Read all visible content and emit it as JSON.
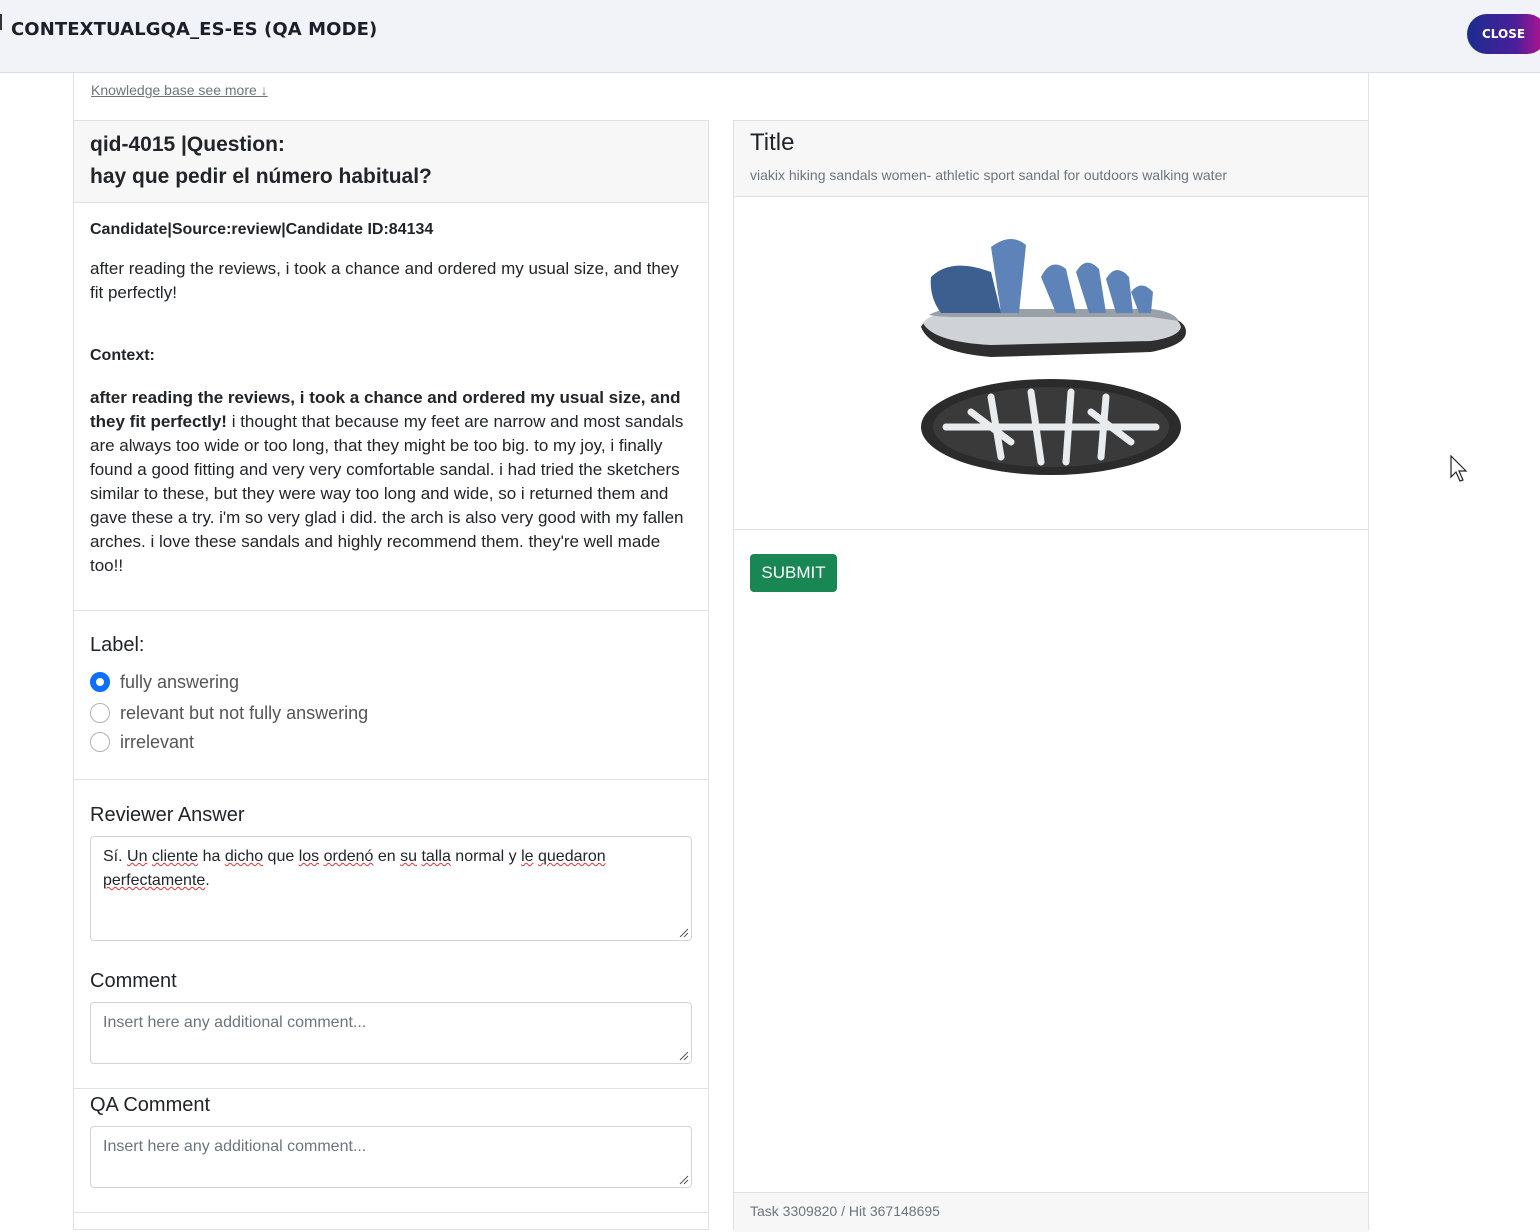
{
  "app": {
    "title": "CONTEXTUALGQA_ES-ES (QA MODE)",
    "close_label": "CLOSE"
  },
  "knowledge": {
    "link": "Knowledge base see more ↓"
  },
  "question": {
    "id_line": "qid-4015 |Question:",
    "text": "hay que pedir el número habitual?"
  },
  "candidate": {
    "title": "Candidate|Source:review|Candidate ID:84134",
    "text": "after reading the reviews, i took a chance and ordered my usual size, and they fit perfectly!"
  },
  "context": {
    "title": "Context:",
    "highlight": "after reading the reviews, i took a chance and ordered my usual size, and they fit perfectly!",
    "rest": " i thought that because my feet are narrow and most sandals are always too wide or too long, that they might be too big. to my joy, i finally found a good fitting and very very comfortable sandal. i had tried the sketchers similar to these, but they were way too long and wide, so i returned them and gave these a try. i'm so very glad i did. the arch is also very good with my fallen arches. i love these sandals and highly recommend them. they're well made too!!"
  },
  "label": {
    "title": "Label:",
    "options": [
      "fully answering",
      "relevant but not fully answering",
      "irrelevant"
    ],
    "selected": "fully answering"
  },
  "reviewer": {
    "title": "Reviewer Answer",
    "value": "Sí. Un cliente ha dicho que los ordenó en su talla normal y le quedaron perfectamente."
  },
  "comment": {
    "title": "Comment",
    "placeholder": "Insert here any additional comment..."
  },
  "qa_comment": {
    "title": "QA Comment",
    "placeholder": "Insert here any additional comment..."
  },
  "product": {
    "title": "Title",
    "subtitle": "viakix hiking sandals women- athletic sport sandal for outdoors walking water",
    "image": "sandal-product-image"
  },
  "submit_label": "SUBMIT",
  "footer": {
    "task": "Task 3309820 / Hit 367148695"
  },
  "colors": {
    "primary": "#0d6efd",
    "success": "#198754",
    "sandal_blue": "#3d5f8f"
  }
}
